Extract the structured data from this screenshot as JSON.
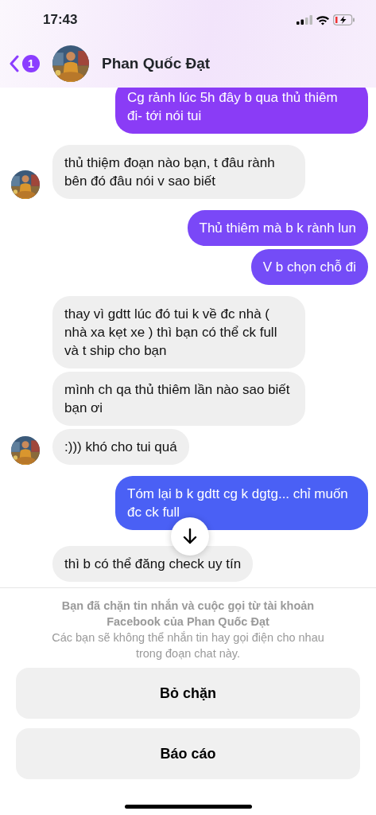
{
  "status_bar": {
    "time": "17:43"
  },
  "header": {
    "unread_count": "1",
    "contact_name": "Phan Quốc Đạt"
  },
  "messages": [
    {
      "kind": "sent",
      "text": "Cg rảnh lúc 5h đây b qua thủ thiêm đi- tới nói tui",
      "color": "#8a3cf6"
    },
    {
      "kind": "received",
      "text": "thủ thiệm đoạn nào bạn, t đâu rành bên đó đâu nói v sao biết",
      "avatar": true
    },
    {
      "kind": "sent",
      "text": "Thủ thiêm mà b k rành lun",
      "color": "#7a48f7"
    },
    {
      "kind": "sent",
      "text": "V b chọn chỗ đi",
      "color": "#744cf7"
    },
    {
      "kind": "received",
      "text": "thay vì gdtt lúc đó tui k về đc nhà ( nhà xa kẹt xe ) thì bạn có thể ck full và t ship cho bạn",
      "avatar": false
    },
    {
      "kind": "received",
      "text": "mình ch qa thủ thiêm lần nào sao biết bạn ơi",
      "avatar": false
    },
    {
      "kind": "received",
      "text": ":))) khó cho tui quá",
      "avatar": true
    },
    {
      "kind": "sent",
      "text": "Tóm lại b k gdtt cg k dgtg... chỉ muốn đc ck full",
      "color": "#4a60f5"
    },
    {
      "kind": "received",
      "text": "thì b có thể đăng check uy tín",
      "avatar": false
    }
  ],
  "blocked_notice": {
    "title": "Bạn đã chặn tin nhắn và cuộc gọi từ tài khoản Facebook của Phan Quốc Đạt",
    "detail": "Các bạn sẽ không thể nhắn tin hay gọi điện cho nhau trong đoạn chat này."
  },
  "actions": [
    "Bỏ chặn",
    "Báo cáo"
  ]
}
